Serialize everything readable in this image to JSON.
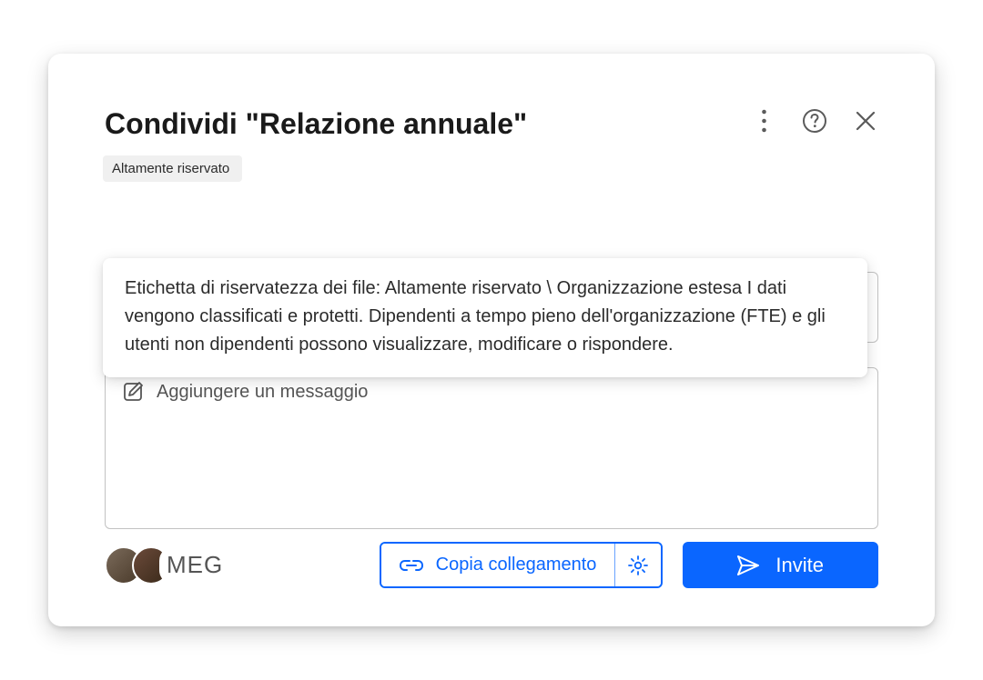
{
  "dialog": {
    "title": "Condividi \"Relazione annuale\"",
    "sensitivity_badge": "Altamente riservato",
    "tooltip_text": "Etichetta di riservatezza dei file: Altamente riservato \\ Organizzazione estesa I dati vengono classificati e protetti. Dipendenti a tempo pieno dell'organizzazione (FTE) e gli utenti non dipendenti possono visualizzare, modificare o rispondere.",
    "message_placeholder": "Aggiungere un messaggio"
  },
  "footer": {
    "avatars_overflow_label": "MEG",
    "copy_link_label": "Copia collegamento",
    "invite_label": "Invite"
  }
}
